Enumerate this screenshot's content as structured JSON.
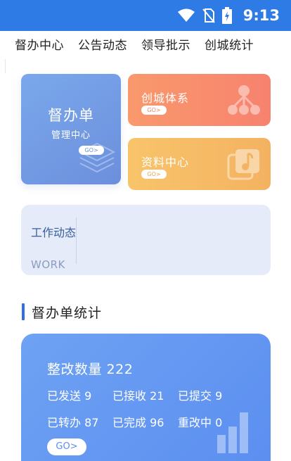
{
  "status_bar": {
    "time": "9:13",
    "icons": [
      "wifi-icon",
      "no-sim-icon",
      "battery-charging-icon"
    ]
  },
  "tabs": [
    "督办中心",
    "公告动态",
    "领导批示",
    "创城统计"
  ],
  "cards": {
    "main": {
      "title": "督办单",
      "subtitle": "管理中心",
      "go": "GO>",
      "icon": "stack-icon"
    },
    "system": {
      "title": "创城体系",
      "go": "GO>",
      "icon": "org-chart-icon"
    },
    "resources": {
      "title": "资料中心",
      "go": "GO>",
      "icon": "music-folder-icon"
    }
  },
  "work": {
    "label": "工作动态",
    "english": "WORK"
  },
  "section": {
    "title": "督办单统计"
  },
  "stats": {
    "total": "整改数量 222",
    "row1": [
      "已发送 9",
      "已接收 21",
      "已提交 9"
    ],
    "row2": [
      "已转办 87",
      "已完成 96",
      "重改中 0"
    ],
    "go": "GO>",
    "icon": "bar-chart-icon"
  },
  "colors": {
    "status_bar": "#2f7be6",
    "main_card": "#7aa8ec",
    "orange_card": "#f9996c",
    "yellow_card": "#f8c46a",
    "work_card": "#e5ebf9",
    "stats_card": "#6ea2f3",
    "accent": "#2f6fe3"
  }
}
